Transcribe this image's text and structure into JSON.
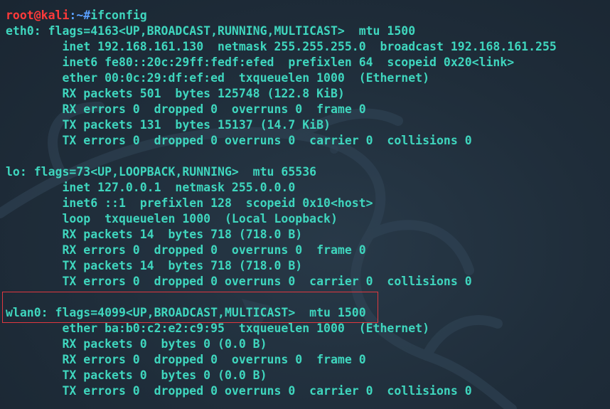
{
  "prompt": {
    "user_host": "root@kali",
    "separator": ":~",
    "symbol": "#",
    "command": "ifconfig"
  },
  "output_lines": [
    "eth0: flags=4163<UP,BROADCAST,RUNNING,MULTICAST>  mtu 1500",
    "        inet 192.168.161.130  netmask 255.255.255.0  broadcast 192.168.161.255",
    "        inet6 fe80::20c:29ff:fedf:efed  prefixlen 64  scopeid 0x20<link>",
    "        ether 00:0c:29:df:ef:ed  txqueuelen 1000  (Ethernet)",
    "        RX packets 501  bytes 125748 (122.8 KiB)",
    "        RX errors 0  dropped 0  overruns 0  frame 0",
    "        TX packets 131  bytes 15137 (14.7 KiB)",
    "        TX errors 0  dropped 0 overruns 0  carrier 0  collisions 0",
    "",
    "lo: flags=73<UP,LOOPBACK,RUNNING>  mtu 65536",
    "        inet 127.0.0.1  netmask 255.0.0.0",
    "        inet6 ::1  prefixlen 128  scopeid 0x10<host>",
    "        loop  txqueuelen 1000  (Local Loopback)",
    "        RX packets 14  bytes 718 (718.0 B)",
    "        RX errors 0  dropped 0  overruns 0  frame 0",
    "        TX packets 14  bytes 718 (718.0 B)",
    "        TX errors 0  dropped 0 overruns 0  carrier 0  collisions 0",
    "",
    "wlan0: flags=4099<UP,BROADCAST,MULTICAST>  mtu 1500",
    "        ether ba:b0:c2:e2:c9:95  txqueuelen 1000  (Ethernet)",
    "        RX packets 0  bytes 0 (0.0 B)",
    "        RX errors 0  dropped 0  overruns 0  frame 0",
    "        TX packets 0  bytes 0 (0.0 B)",
    "        TX errors 0  dropped 0 overruns 0  carrier 0  collisions 0"
  ],
  "colors": {
    "background": "#1e2b38",
    "text": "#3fd6be",
    "prompt_user": "#ff3a3a",
    "prompt_path": "#5aa0ff",
    "highlight_border": "#e0383f"
  }
}
